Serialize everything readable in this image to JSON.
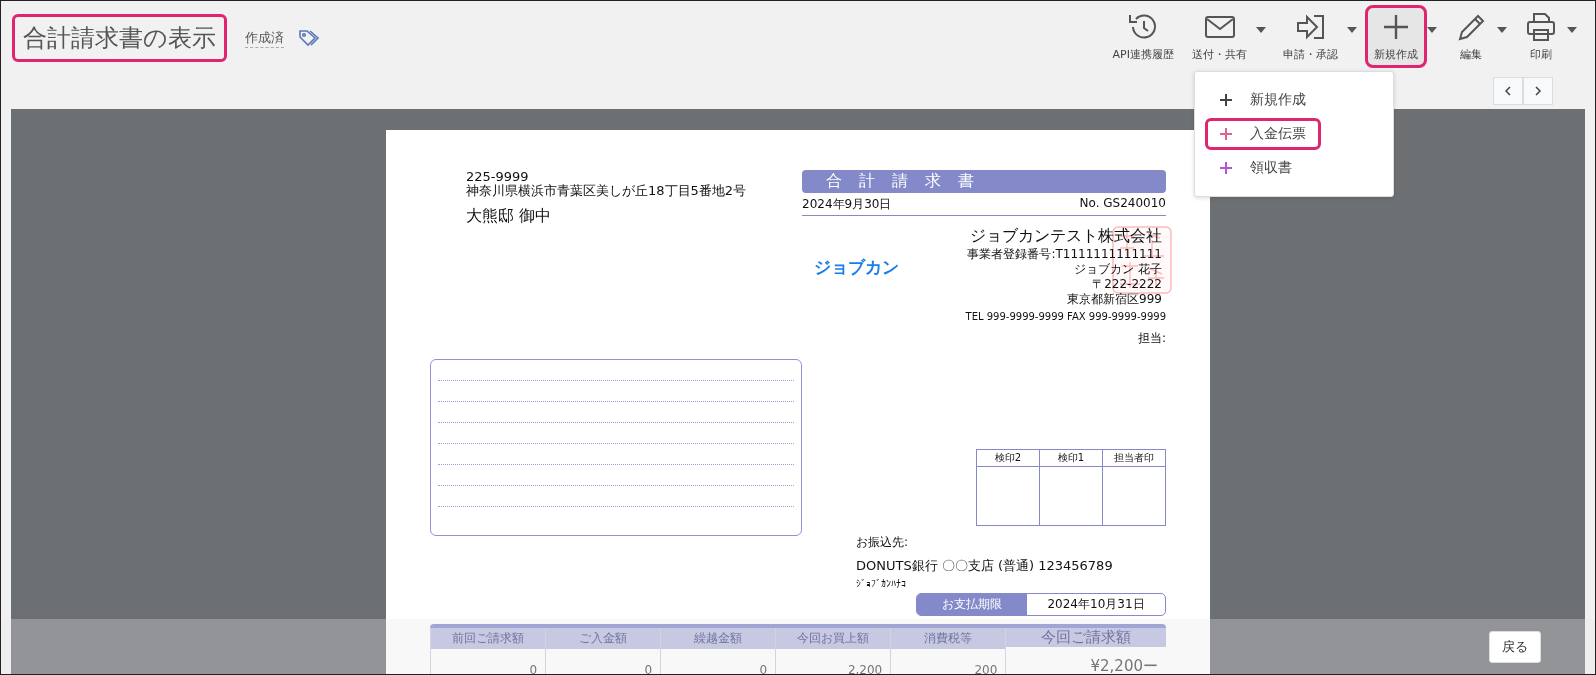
{
  "header": {
    "title": "合計請求書の表示",
    "title_highlighted": true,
    "status": "作成済"
  },
  "toolbar": [
    {
      "label": "API連携履歴",
      "dropdown": false,
      "highlighted": false
    },
    {
      "label": "送付・共有",
      "dropdown": true,
      "highlighted": false
    },
    {
      "label": "申請・承認",
      "dropdown": true,
      "highlighted": false
    },
    {
      "label": "新規作成",
      "dropdown": true,
      "highlighted": true
    },
    {
      "label": "編集",
      "dropdown": true,
      "highlighted": false
    },
    {
      "label": "印刷",
      "dropdown": true,
      "highlighted": false
    }
  ],
  "menu": [
    {
      "label": "新規作成",
      "color": "#444444",
      "highlighted": false
    },
    {
      "label": "入金伝票",
      "color": "#e0609a",
      "highlighted": true
    },
    {
      "label": "領収書",
      "color": "#b455d8",
      "highlighted": false
    }
  ],
  "document": {
    "postal_code": "225-9999",
    "address": "神奈川県横浜市青葉区美しが丘18丁目5番地2号",
    "recipient": "大熊邸 御中",
    "title": "合 計 請 求 書",
    "date": "2024年9月30日",
    "number": "No. GS240010",
    "logo": "ジョブカン",
    "company": "ジョブカンテスト株式会社",
    "company_lines": [
      "事業者登録番号:T1111111111111",
      "ジョブカン 花子",
      "〒222-2222",
      "東京都新宿区999"
    ],
    "contact": "TEL 999-9999-9999 FAX 999-9999-9999",
    "staff": "担当:",
    "stamp_columns": [
      "検印2",
      "検印1",
      "担当者印"
    ],
    "bank_label": "お振込先:",
    "bank": "DONUTS銀行 〇〇支店 (普通) 123456789",
    "account_name": "ｼﾞｮﾌﾞｶﾝﾊﾅｺ",
    "due_label": "お支払期限",
    "due_date": "2024年10月31日",
    "summary_columns": [
      "前回ご請求額",
      "ご入金額",
      "繰越金額",
      "今回お買上額",
      "消費税等",
      "今回ご請求額"
    ],
    "summary_values": [
      "0",
      "0",
      "0",
      "2,200",
      "200",
      "¥2,200ー"
    ]
  },
  "footer": {
    "back_button": "戻る"
  }
}
